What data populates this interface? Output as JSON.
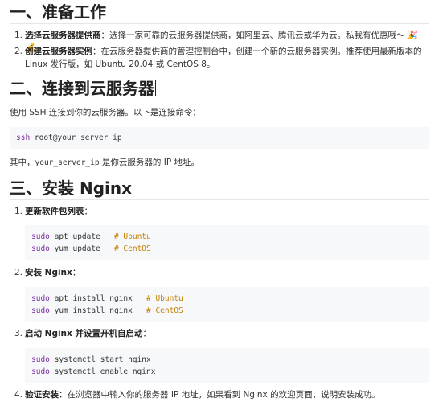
{
  "sections": {
    "s1": {
      "title": "一、准备工作",
      "items": [
        {
          "num": "1.",
          "bold": "选择云服务器提供商",
          "text": "：选择一家可靠的云服务器提供商，如阿里云、腾讯云或华为云。私我有优惠哦～",
          "emoji": "🎉💰"
        },
        {
          "num": "2.",
          "bold": "创建云服务器实例",
          "text": "：在云服务器提供商的管理控制台中，创建一个新的云服务器实例。推荐使用最新版本的 Linux 发行版，如 Ubuntu 20.04 或 CentOS 8。"
        }
      ]
    },
    "s2": {
      "title": "二、连接到云服务器",
      "intro": "使用 SSH 连接到你的云服务器。以下是连接命令：",
      "code": [
        {
          "kw": "ssh",
          "rest": " root@your_server_ip",
          "comment": ""
        }
      ],
      "note_prefix": "其中，",
      "note_code": "your_server_ip",
      "note_suffix": " 是你云服务器的 IP 地址。"
    },
    "s3": {
      "title": "三、安装 Nginx",
      "steps": [
        {
          "num": "1.",
          "bold": "更新软件包列表",
          "text": "：",
          "code": [
            {
              "kw": "sudo",
              "rest": " apt update   ",
              "comment": "# Ubuntu"
            },
            {
              "kw": "sudo",
              "rest": " yum update   ",
              "comment": "# CentOS"
            }
          ]
        },
        {
          "num": "2.",
          "bold": "安装 Nginx",
          "text": "：",
          "code": [
            {
              "kw": "sudo",
              "rest": " apt install nginx   ",
              "comment": "# Ubuntu"
            },
            {
              "kw": "sudo",
              "rest": " yum install nginx   ",
              "comment": "# CentOS"
            }
          ]
        },
        {
          "num": "3.",
          "bold": "启动 Nginx 并设置开机自启动",
          "text": "：",
          "code": [
            {
              "kw": "sudo",
              "rest": " systemctl start nginx",
              "comment": ""
            },
            {
              "kw": "sudo",
              "rest": " systemctl enable nginx",
              "comment": ""
            }
          ]
        },
        {
          "num": "4.",
          "bold": "验证安装",
          "text": "：在浏览器中输入你的服务器 IP 地址，如果看到 Nginx 的欢迎页面，说明安装成功。"
        }
      ]
    }
  }
}
